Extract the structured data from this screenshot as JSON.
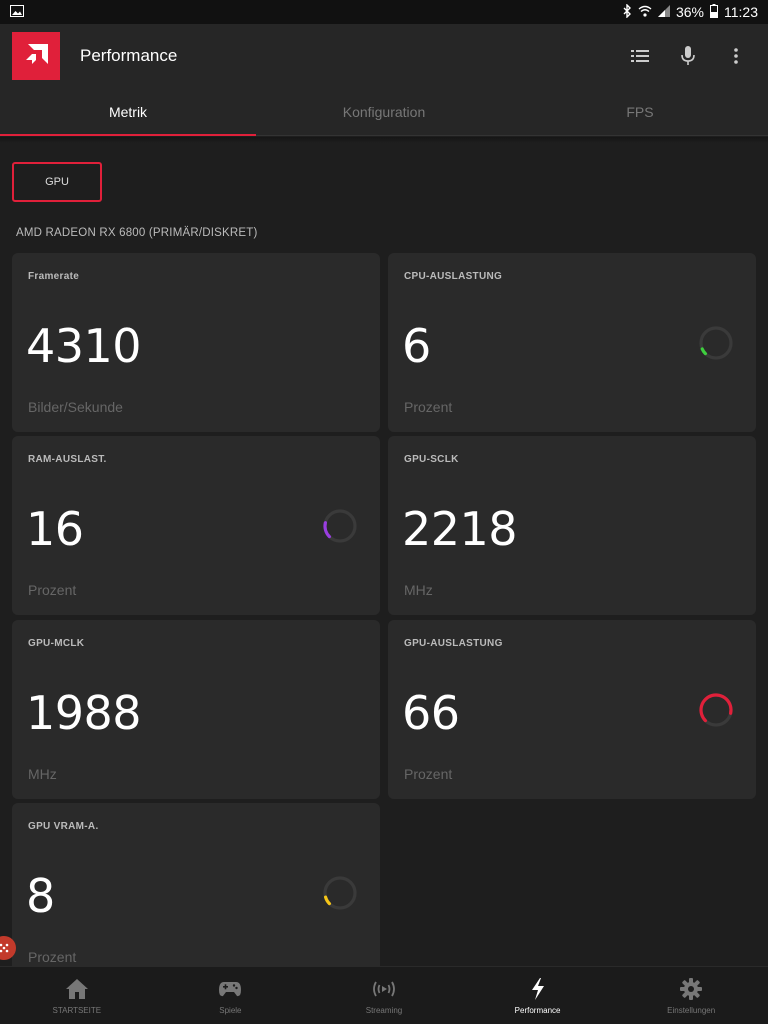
{
  "status": {
    "percent": "36%",
    "time": "11:23",
    "icons": [
      "image-icon",
      "bluetooth-icon",
      "wifi-icon",
      "signal-icon",
      "battery-icon"
    ]
  },
  "appbar": {
    "title": "Performance",
    "logo": "amd-logo",
    "actions": [
      "list-icon",
      "microphone-icon",
      "more-vert-icon"
    ]
  },
  "tabs": [
    {
      "label": "Metrik",
      "active": true
    },
    {
      "label": "Konfiguration",
      "active": false
    },
    {
      "label": "FPS",
      "active": false
    }
  ],
  "gpu_button": "GPU",
  "device": "AMD RADEON RX 6800 (PRIMÄR/DISKRET)",
  "cards": [
    {
      "label": "Framerate",
      "value": "4310",
      "unit": "Bilder/Sekunde"
    },
    {
      "label": "CPU-AUSLASTUNG",
      "value": "6",
      "unit": "Prozent",
      "gauge_color": "#3ecf3e",
      "gauge_fraction": 0.06
    },
    {
      "label": "RAM-AUSLAST.",
      "value": "16",
      "unit": "Prozent",
      "gauge_color": "#9a3ee0",
      "gauge_fraction": 0.16
    },
    {
      "label": "GPU-SCLK",
      "value": "2218",
      "unit": "MHz"
    },
    {
      "label": "GPU-MCLK",
      "value": "1988",
      "unit": "MHz"
    },
    {
      "label": "GPU-AUSLASTUNG",
      "value": "66",
      "unit": "Prozent",
      "gauge_color": "#e0203a",
      "gauge_fraction": 0.66
    },
    {
      "label": "GPU VRAM-A.",
      "value": "8",
      "unit": "Prozent",
      "gauge_color": "#f5c518",
      "gauge_fraction": 0.08
    }
  ],
  "nav": [
    {
      "label": "STARTSEITE",
      "icon": "home-icon",
      "active": false
    },
    {
      "label": "Spiele",
      "icon": "gamepad-icon",
      "active": false
    },
    {
      "label": "Streaming",
      "icon": "streaming-icon",
      "active": false
    },
    {
      "label": "Performance",
      "icon": "bolt-icon",
      "active": true
    },
    {
      "label": "Einstellungen",
      "icon": "gear-icon",
      "active": false
    }
  ],
  "colors": {
    "accent": "#e0203a",
    "card": "#2a2a2a",
    "background": "#1e1e1e"
  }
}
